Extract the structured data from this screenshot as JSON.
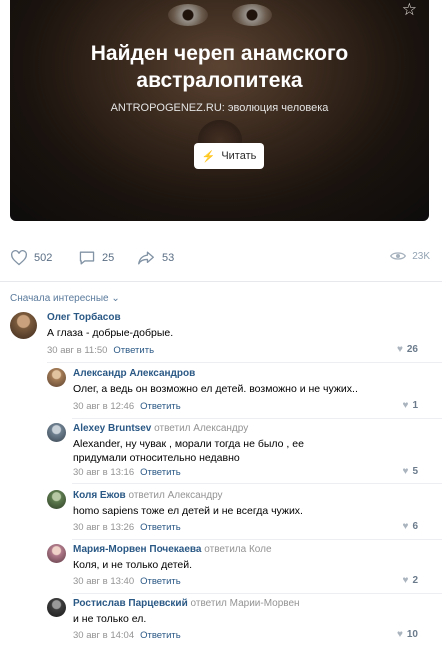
{
  "article": {
    "title": "Найден череп анамского австралопитека",
    "source": "ANTROPOGENEZ.RU: эволюция человека",
    "read_label": "Читать"
  },
  "actions": {
    "likes": "502",
    "comments": "25",
    "shares": "53",
    "views": "23K"
  },
  "sort_label": "Сначала интересные",
  "comments": [
    {
      "author": "Олег Торбасов",
      "reply_to": "",
      "text": "А глаза - добрые-добрые.",
      "time": "30 авг в 11:50",
      "answer": "Ответить",
      "likes": "26",
      "avatar": "#7a5a3c"
    },
    {
      "author": "Александр Александров",
      "reply_to": "",
      "text": "Олег, а ведь он возможно ел детей. возможно и не чужих..",
      "time": "30 авг в 12:46",
      "answer": "Ответить",
      "likes": "1",
      "avatar": "#a37b55"
    },
    {
      "author": "Alexey Bruntsev",
      "reply_to": "ответил Александру",
      "text": "Alexander, ну чувак , морали тогда не было , ее придумали относительно недавно",
      "time": "30 авг в 13:16",
      "answer": "Ответить",
      "likes": "5",
      "avatar": "#6d7f8f"
    },
    {
      "author": "Коля Ежов",
      "reply_to": "ответил Александру",
      "text": "homo sapiens тоже ел детей и не всегда чужих.",
      "time": "30 авг в 13:26",
      "answer": "Ответить",
      "likes": "6",
      "avatar": "#5d7a4e"
    },
    {
      "author": "Мария-Морвен Почекаева",
      "reply_to": "ответила Коле",
      "text": "Коля, и не только детей.",
      "time": "30 авг в 13:40",
      "answer": "Ответить",
      "likes": "2",
      "avatar": "#b07a8a"
    },
    {
      "author": "Ростислав Парцевский",
      "reply_to": "ответил Марии-Морвен",
      "text": "и не только ел.",
      "time": "30 авг в 14:04",
      "answer": "Ответить",
      "likes": "10",
      "avatar": "#3c3c3c"
    }
  ]
}
